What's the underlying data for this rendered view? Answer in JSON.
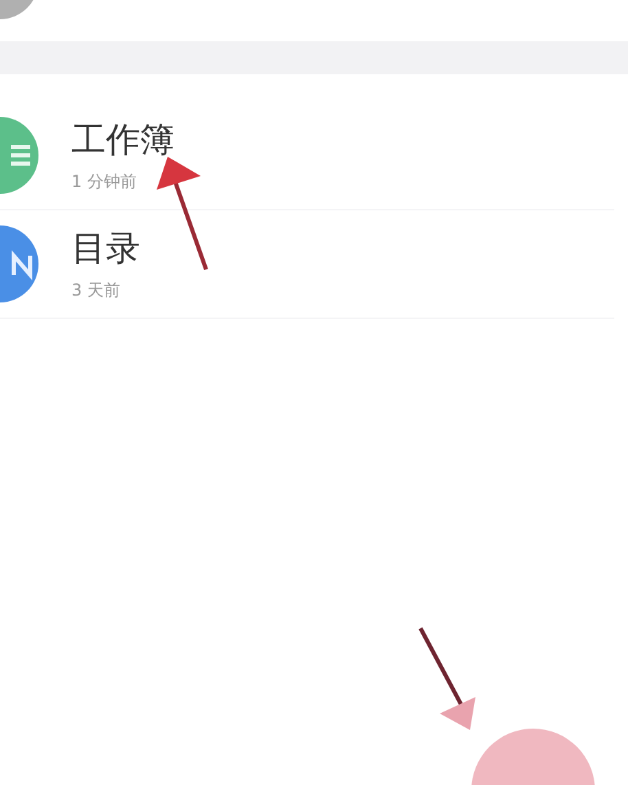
{
  "top_item": {
    "color": "#b0b0b0"
  },
  "files": [
    {
      "title": "工作簿",
      "time": "1 分钟前",
      "color": "#5cbf8a",
      "kind": "sheet"
    },
    {
      "title": "目录",
      "time": "3 天前",
      "color": "#4a8fe6",
      "kind": "note"
    }
  ],
  "fab": {
    "color": "#f0b8c0"
  }
}
